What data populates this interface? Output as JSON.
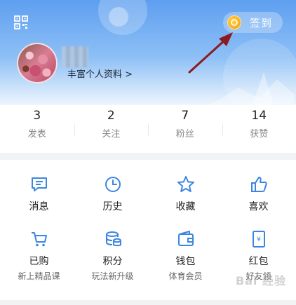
{
  "header": {
    "checkin_label": "签到",
    "profile_link": "丰富个人资料 >"
  },
  "stats": [
    {
      "value": "3",
      "label": "发表"
    },
    {
      "value": "2",
      "label": "关注"
    },
    {
      "value": "7",
      "label": "粉丝"
    },
    {
      "value": "14",
      "label": "获赞"
    }
  ],
  "menu_row1": [
    {
      "label": "消息",
      "icon": "message-icon"
    },
    {
      "label": "历史",
      "icon": "clock-icon"
    },
    {
      "label": "收藏",
      "icon": "star-icon"
    },
    {
      "label": "喜欢",
      "icon": "thumbs-up-icon"
    }
  ],
  "menu_row2": [
    {
      "label": "已购",
      "sub": "新上精品课",
      "icon": "cart-icon"
    },
    {
      "label": "积分",
      "sub": "玩法新升级",
      "icon": "coins-icon"
    },
    {
      "label": "钱包",
      "sub": "体育会员",
      "icon": "wallet-icon"
    },
    {
      "label": "红包",
      "sub": "好友领",
      "icon": "red-envelope-icon"
    }
  ],
  "colors": {
    "accent": "#3b86e0",
    "header_top": "#5e9ff0",
    "arrow": "#8b1a22",
    "coin": "#f29a05"
  },
  "watermark": "Bai 经验"
}
